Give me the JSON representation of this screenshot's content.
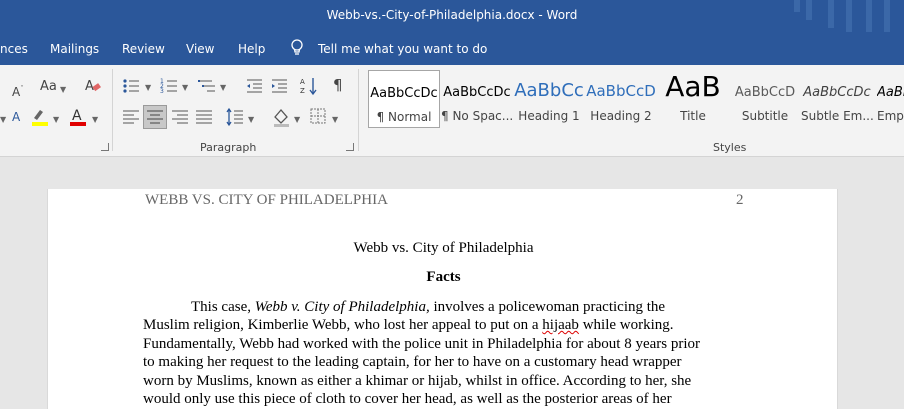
{
  "window": {
    "title": "Webb-vs.-City-of-Philadelphia.docx  -  Word"
  },
  "tabs": {
    "references": "nces",
    "mailings": "Mailings",
    "review": "Review",
    "view": "View",
    "help": "Help",
    "tell_me": "Tell me what you want to do"
  },
  "ribbon": {
    "font": {
      "change_case_label": "Aa"
    },
    "paragraph": {
      "label": "Paragraph"
    },
    "styles": {
      "label": "Styles",
      "items": [
        {
          "sample": "AaBbCcDc",
          "name": "¶ Normal"
        },
        {
          "sample": "AaBbCcDc",
          "name": "¶ No Spac..."
        },
        {
          "sample": "AaBbCc",
          "name": "Heading 1"
        },
        {
          "sample": "AaBbCcD",
          "name": "Heading 2"
        },
        {
          "sample": "AaB",
          "name": "Title"
        },
        {
          "sample": "AaBbCcD",
          "name": "Subtitle"
        },
        {
          "sample": "AaBbCcDc",
          "name": "Subtle Em..."
        },
        {
          "sample": "AaBb",
          "name": "Emp"
        }
      ]
    }
  },
  "colors": {
    "accent": "#2b579a",
    "highlight": "#ffff00",
    "font_color": "#e00000"
  },
  "document": {
    "running_head": "WEBB VS. CITY OF PHILADELPHIA",
    "page_number": "2",
    "title": "Webb vs. City of Philadelphia",
    "heading": "Facts",
    "lines": [
      {
        "a": "This case, ",
        "italic": "Webb v. City of Philadelphia,",
        "b": " involves a policewoman practicing the"
      },
      {
        "a": "Muslim religion, Kimberlie Webb, who lost her appeal to put on a ",
        "err": "hijaab",
        "b": " while working."
      },
      {
        "text": "Fundamentally, Webb had worked with the police unit in Philadelphia for about 8 years prior"
      },
      {
        "text": "to making her request to the leading captain, for her to have on a customary head wrapper"
      },
      {
        "text": "worn by Muslims, known as either a khimar or hijab, whilst in office. According to her, she"
      },
      {
        "text": "would only use this piece of cloth to cover her head, as well as the posterior areas of her"
      }
    ]
  }
}
